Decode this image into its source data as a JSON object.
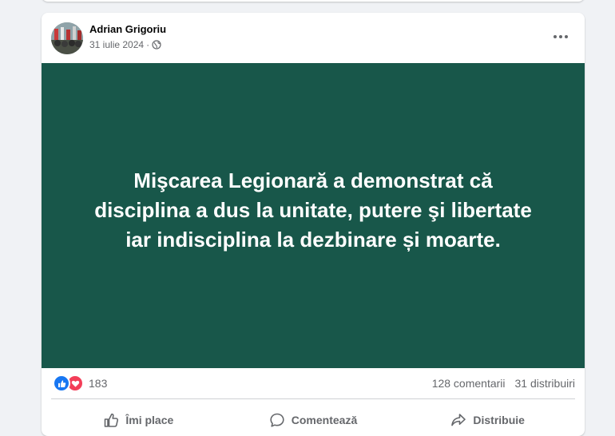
{
  "post": {
    "author": "Adrian Grigoriu",
    "date": "31 iulie 2024",
    "separator": "·",
    "privacy_icon": "globe-icon",
    "background_color": "#18574a",
    "text": "Mişcarea Legionară a demonstrat că disciplina a dus la unitate, putere şi libertate iar indisciplina la dezbinare și moarte."
  },
  "stats": {
    "reaction_icons": [
      "like-icon",
      "love-icon"
    ],
    "reaction_count": "183",
    "comments": "128 comentarii",
    "shares": "31 distribuiri"
  },
  "actions": {
    "like": "Îmi place",
    "comment": "Comentează",
    "share": "Distribuie"
  },
  "colors": {
    "like_blue": "#1877f2",
    "love_red": "#f33e58",
    "secondary_text": "#65676b",
    "page_bg": "#f0f2f5"
  }
}
